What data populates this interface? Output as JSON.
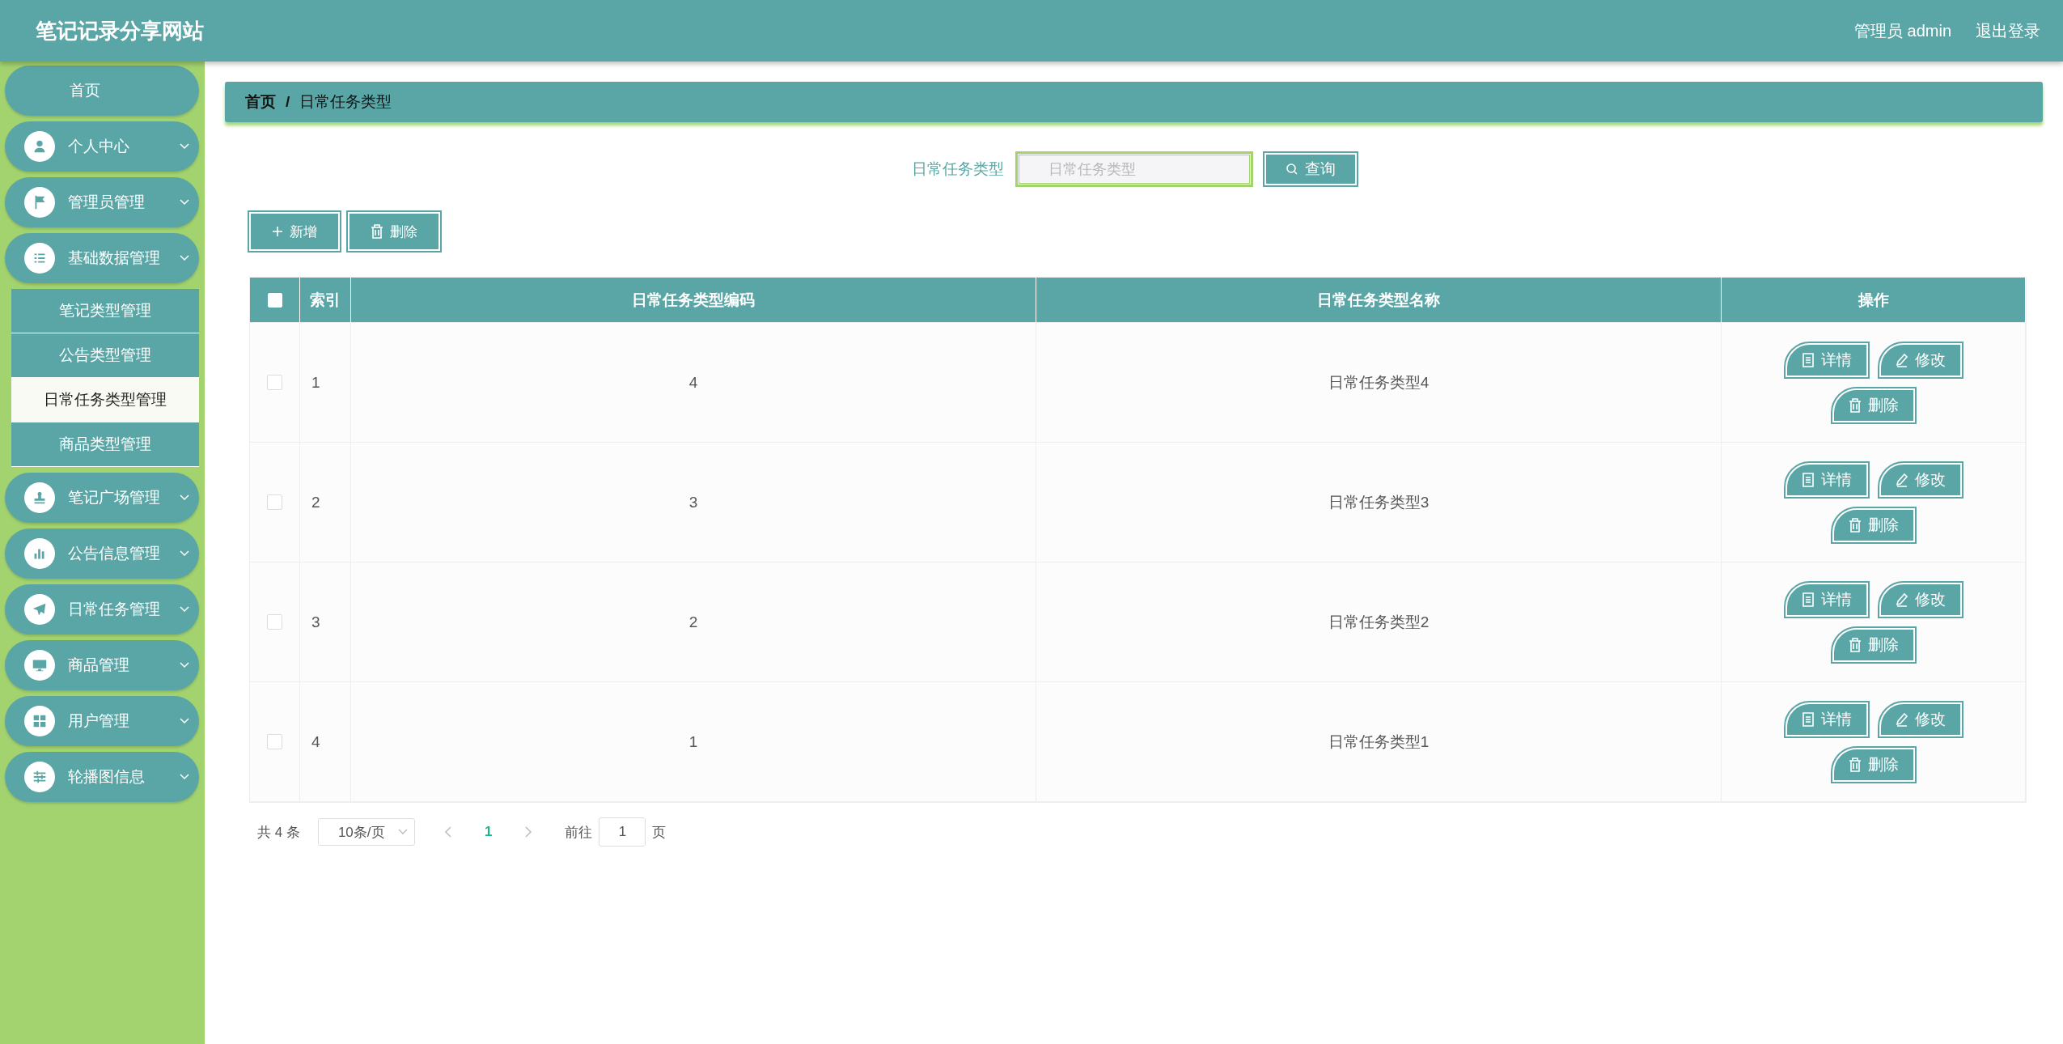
{
  "header": {
    "title": "笔记记录分享网站",
    "user": "管理员 admin",
    "logout": "退出登录"
  },
  "sidebar": {
    "items": [
      {
        "label": "首页",
        "kind": "link"
      },
      {
        "label": "个人中心",
        "kind": "group"
      },
      {
        "label": "管理员管理",
        "kind": "group"
      },
      {
        "label": "基础数据管理",
        "kind": "group",
        "children": [
          {
            "label": "笔记类型管理",
            "selected": false
          },
          {
            "label": "公告类型管理",
            "selected": false
          },
          {
            "label": "日常任务类型管理",
            "selected": true
          },
          {
            "label": "商品类型管理",
            "selected": false
          }
        ]
      },
      {
        "label": "笔记广场管理",
        "kind": "group"
      },
      {
        "label": "公告信息管理",
        "kind": "group"
      },
      {
        "label": "日常任务管理",
        "kind": "group"
      },
      {
        "label": "商品管理",
        "kind": "group"
      },
      {
        "label": "用户管理",
        "kind": "group"
      },
      {
        "label": "轮播图信息",
        "kind": "group"
      }
    ]
  },
  "breadcrumb": {
    "items": [
      "首页",
      "日常任务类型"
    ],
    "separator": "/"
  },
  "search": {
    "label": "日常任务类型",
    "placeholder": "日常任务类型",
    "button": "查询"
  },
  "toolbar": [
    "新增",
    "删除"
  ],
  "table": {
    "select_all_checked": false,
    "columns": [
      "索引",
      "日常任务类型编码",
      "日常任务类型名称",
      "操作"
    ],
    "rows": [
      {
        "checked": false,
        "index": "1",
        "code": "4",
        "name": "日常任务类型4",
        "actions": [
          "详情",
          "修改",
          "删除"
        ]
      },
      {
        "checked": false,
        "index": "2",
        "code": "3",
        "name": "日常任务类型3",
        "actions": [
          "详情",
          "修改",
          "删除"
        ]
      },
      {
        "checked": false,
        "index": "3",
        "code": "2",
        "name": "日常任务类型2",
        "actions": [
          "详情",
          "修改",
          "删除"
        ]
      },
      {
        "checked": false,
        "index": "4",
        "code": "1",
        "name": "日常任务类型1",
        "actions": [
          "详情",
          "修改",
          "删除"
        ]
      }
    ]
  },
  "pagination": {
    "total": "共 4 条",
    "page_size": "10条/页",
    "pages": [
      {
        "label": "1",
        "selected": true
      }
    ],
    "goto_label": "前往",
    "goto_value": "1",
    "goto_suffix": "页"
  }
}
